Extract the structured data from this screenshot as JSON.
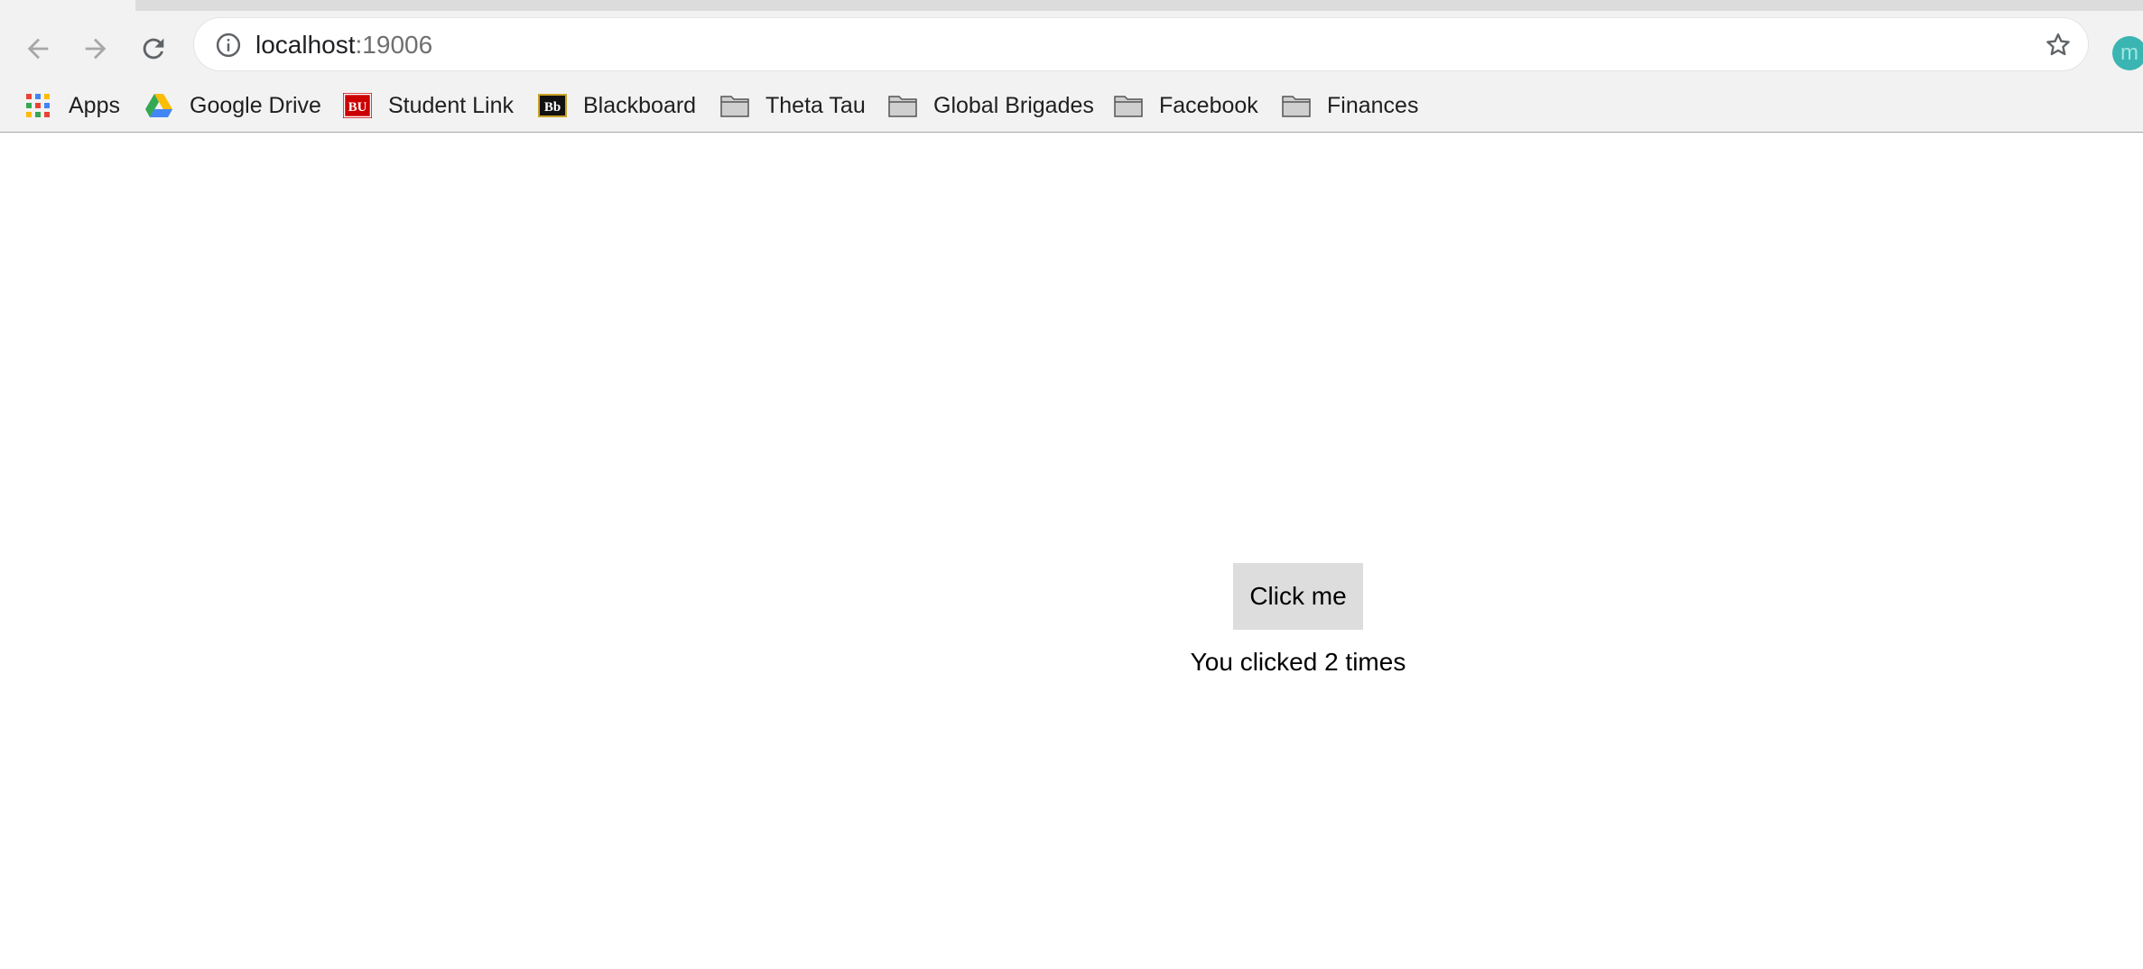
{
  "browser": {
    "address_bar": {
      "host": "localhost",
      "port": ":19006"
    },
    "profile_initial": "m",
    "bookmarks": [
      {
        "label": "Apps",
        "icon": "apps-grid-icon"
      },
      {
        "label": "Google Drive",
        "icon": "google-drive-icon"
      },
      {
        "label": "Student Link",
        "icon": "bu-icon",
        "icon_text": "BU"
      },
      {
        "label": "Blackboard",
        "icon": "blackboard-icon",
        "icon_text": "Bb"
      },
      {
        "label": "Theta Tau",
        "icon": "folder-icon"
      },
      {
        "label": "Global Brigades",
        "icon": "folder-icon"
      },
      {
        "label": "Facebook",
        "icon": "folder-icon"
      },
      {
        "label": "Finances",
        "icon": "folder-icon"
      }
    ]
  },
  "page": {
    "button_label": "Click me",
    "counter_text": "You clicked 2 times"
  },
  "colors": {
    "toolbar_bg": "#f2f2f2",
    "button_bg": "#dddddd",
    "profile_avatar": "#3bb5b2",
    "bu_red": "#cc0000"
  }
}
